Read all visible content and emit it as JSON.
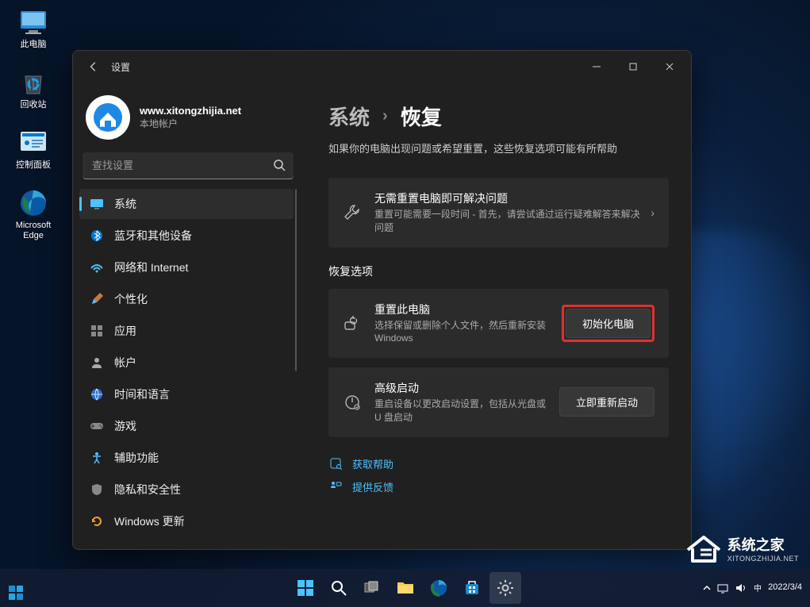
{
  "desktop_icons": [
    {
      "id": "this-pc",
      "label": "此电脑"
    },
    {
      "id": "recycle-bin",
      "label": "回收站"
    },
    {
      "id": "control-panel",
      "label": "控制面板"
    },
    {
      "id": "edge",
      "label": "Microsoft\nEdge"
    }
  ],
  "window": {
    "app_title": "设置",
    "account": {
      "name": "www.xitongzhijia.net",
      "type": "本地帐户"
    },
    "search_placeholder": "查找设置",
    "nav": [
      {
        "id": "system",
        "label": "系统",
        "active": true
      },
      {
        "id": "bluetooth",
        "label": "蓝牙和其他设备"
      },
      {
        "id": "network",
        "label": "网络和 Internet"
      },
      {
        "id": "personalization",
        "label": "个性化"
      },
      {
        "id": "apps",
        "label": "应用"
      },
      {
        "id": "accounts",
        "label": "帐户"
      },
      {
        "id": "time-lang",
        "label": "时间和语言"
      },
      {
        "id": "gaming",
        "label": "游戏"
      },
      {
        "id": "accessibility",
        "label": "辅助功能"
      },
      {
        "id": "privacy",
        "label": "隐私和安全性"
      },
      {
        "id": "update",
        "label": "Windows 更新"
      }
    ]
  },
  "main": {
    "breadcrumb_parent": "系统",
    "breadcrumb_chevron": "›",
    "breadcrumb_current": "恢复",
    "description": "如果你的电脑出现问题或希望重置，这些恢复选项可能有所帮助",
    "troubleshoot": {
      "title": "无需重置电脑即可解决问题",
      "sub": "重置可能需要一段时间 - 首先，请尝试通过运行疑难解答来解决问题"
    },
    "section_title": "恢复选项",
    "reset": {
      "title": "重置此电脑",
      "sub": "选择保留或删除个人文件，然后重新安装 Windows",
      "button": "初始化电脑"
    },
    "advanced": {
      "title": "高级启动",
      "sub": "重启设备以更改启动设置，包括从光盘或 U 盘启动",
      "button": "立即重新启动"
    },
    "help_link": "获取帮助",
    "feedback_link": "提供反馈"
  },
  "taskbar": {
    "time": "",
    "date": "2022/3/4"
  },
  "watermark": {
    "title": "系统之家",
    "url": "XITONGZHIJIA.NET"
  }
}
